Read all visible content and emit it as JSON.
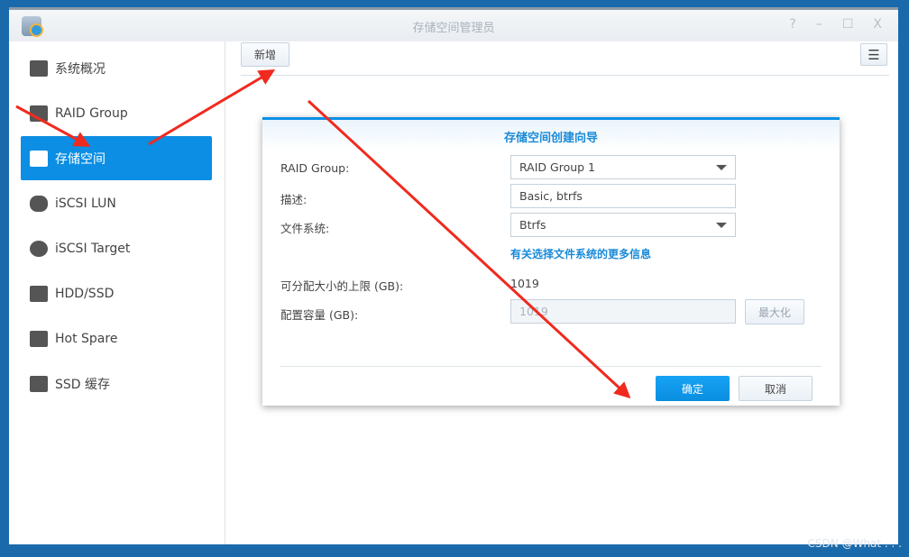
{
  "window": {
    "title": "存储空间管理员",
    "controls": [
      "?",
      "–",
      "☐",
      "X"
    ]
  },
  "sidebar": {
    "items": [
      {
        "label": "系统概况",
        "icon": "overview-icon"
      },
      {
        "label": "RAID Group",
        "icon": "raid-icon"
      },
      {
        "label": "存储空间",
        "icon": "cubes-icon",
        "active": true
      },
      {
        "label": "iSCSI LUN",
        "icon": "database-icon"
      },
      {
        "label": "iSCSI Target",
        "icon": "globe-icon"
      },
      {
        "label": "HDD/SSD",
        "icon": "disk-icon"
      },
      {
        "label": "Hot Spare",
        "icon": "plus-disk-icon"
      },
      {
        "label": "SSD 缓存",
        "icon": "ssd-icon"
      }
    ]
  },
  "toolbar": {
    "add_label": "新增",
    "sort_icon": "sort-icon"
  },
  "dialog": {
    "title": "存储空间创建向导",
    "raid_label": "RAID Group:",
    "raid_value": "RAID Group 1",
    "desc_label": "描述:",
    "desc_value": "Basic, btrfs",
    "fs_label": "文件系统:",
    "fs_value": "Btrfs",
    "fs_link": "有关选择文件系统的更多信息",
    "max_label": "可分配大小的上限 (GB):",
    "max_value": "1019",
    "cap_label": "配置容量 (GB):",
    "cap_value": "1019",
    "maximize_label": "最大化",
    "ok_label": "确定",
    "cancel_label": "取消"
  },
  "annotation_color": "#f02a1e",
  "watermark": "CSDN @What . . ."
}
